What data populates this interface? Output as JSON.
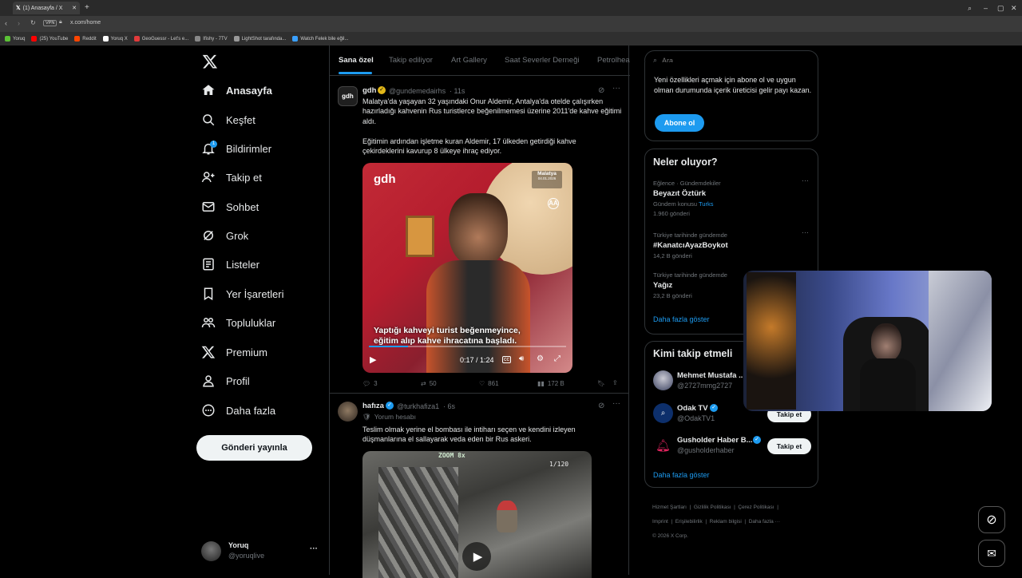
{
  "browser": {
    "tab_title": "(1) Anasayfa / X",
    "url": "x.com/home",
    "vpn_label": "VPN",
    "bookmarks": [
      {
        "label": "Yoruq",
        "color": "#5bc236"
      },
      {
        "label": "(25) YouTube",
        "color": "#ff0000"
      },
      {
        "label": "Reddit",
        "color": "#ff4500"
      },
      {
        "label": "Yoruq X",
        "color": "#ffffff"
      },
      {
        "label": "GeoGuessr - Let's e...",
        "color": "#e23b3b"
      },
      {
        "label": "Ifishy - 7TV",
        "color": "#888888"
      },
      {
        "label": "LightShot tarafında...",
        "color": "#999999"
      },
      {
        "label": "Watch Felek bile eğil...",
        "color": "#3aa0ff"
      }
    ]
  },
  "nav": {
    "items": [
      {
        "label": "Anasayfa",
        "icon": "home-icon"
      },
      {
        "label": "Keşfet",
        "icon": "search-icon"
      },
      {
        "label": "Bildirimler",
        "icon": "bell-icon"
      },
      {
        "label": "Takip et",
        "icon": "add-user-icon"
      },
      {
        "label": "Sohbet",
        "icon": "mail-icon"
      },
      {
        "label": "Grok",
        "icon": "grok-icon"
      },
      {
        "label": "Listeler",
        "icon": "list-icon"
      },
      {
        "label": "Yer İşaretleri",
        "icon": "bookmark-icon"
      },
      {
        "label": "Topluluklar",
        "icon": "community-icon"
      },
      {
        "label": "Premium",
        "icon": "x-logo-icon"
      },
      {
        "label": "Profil",
        "icon": "profile-icon"
      },
      {
        "label": "Daha fazla",
        "icon": "more-circle-icon"
      }
    ],
    "notification_badge": "1",
    "post_button": "Gönderi yayınla",
    "account_name": "Yoruq",
    "account_handle": "@yoruqlive",
    "account_more": "···"
  },
  "tabs": [
    "Sana özel",
    "Takip ediliyor",
    "Art Gallery",
    "Saat Severler Derneği",
    "Petrolhea"
  ],
  "tweet1": {
    "name": "gdh",
    "handle": "@gundemedairhs",
    "time": "· 11s",
    "text1": "Malatya'da yaşayan 32 yaşındaki Onur Aldemir, Antalya'da otelde çalışırken hazırladığı kahvenin Rus turistlerce beğenilmemesi üzerine 2011'de kahve eğitimi aldı.",
    "text2": "Eğitimin ardından işletme kuran Aldemir, 17 ülkeden getirdiği kahve çekirdeklerini kavurup 8 ülkeye ihraç ediyor.",
    "video_logo": "gdh",
    "video_location": "Malatya",
    "video_date": "04.01.2026",
    "video_agency": "AA",
    "video_caption1": "Yaptığı kahveyi turist beğenmeyince,",
    "video_caption2": "eğitim alıp kahve ihracatına başladı.",
    "video_time": "0:17 / 1:24",
    "video_progress": 0.2,
    "replies": "3",
    "reposts": "50",
    "likes": "861",
    "views": "172 B"
  },
  "tweet2": {
    "name": "hafıza",
    "handle": "@turkhafiza1",
    "time": "· 6s",
    "comment_label": "Yorum hesabı",
    "text": "Teslim olmak yerine el bombası ile intiharı seçen ve kendini izleyen düşmanlarına el sallayarak veda eden bir Rus askeri.",
    "video_overlay_text": "ZOOM 8x",
    "video_overlay_right": "1/120"
  },
  "search": {
    "placeholder": "Ara"
  },
  "premium": {
    "text": "Yeni özellikleri açmak için abone ol ve uygun olman durumunda içerik üreticisi gelir payı kazan.",
    "button": "Abone ol"
  },
  "trends": {
    "title": "Neler oluyor?",
    "items": [
      {
        "meta": "Eğlence · Gündemdekiler",
        "name": "Beyazıt Öztürk",
        "extra_prefix": "Gündem konusu",
        "extra_link": "Turks",
        "count": "1.960 gönderi"
      },
      {
        "meta": "Türkiye tarihinde gündemde",
        "name": "#KanatcıAyazBoykot",
        "count": "14,2 B gönderi"
      },
      {
        "meta": "Türkiye tarihinde gündemde",
        "name": "Yağız",
        "count": "23,2 B gönderi"
      }
    ],
    "show_more": "Daha fazla göster"
  },
  "who_to_follow": {
    "title": "Kimi takip etmeli",
    "items": [
      {
        "name": "Mehmet Mustafa ...",
        "handle": "@2727mmg2727",
        "button": "Takip et"
      },
      {
        "name": "Odak TV",
        "handle": "@OdakTV1",
        "button": "Takip et"
      },
      {
        "name": "Gusholder Haber B...",
        "handle": "@gusholderhaber",
        "button": "Takip et"
      }
    ],
    "show_more": "Daha fazla göster"
  },
  "footer": {
    "links": [
      "Hizmet Şartları",
      "Gizlilik Politikası",
      "Çerez Politikası",
      "Imprint",
      "Erişilebilirlik",
      "Reklam bilgisi",
      "Daha fazla ···"
    ],
    "copyright": "© 2026 X Corp."
  },
  "colors": {
    "accent": "#1d9bf0",
    "background": "#000000",
    "border": "#2f3336"
  }
}
